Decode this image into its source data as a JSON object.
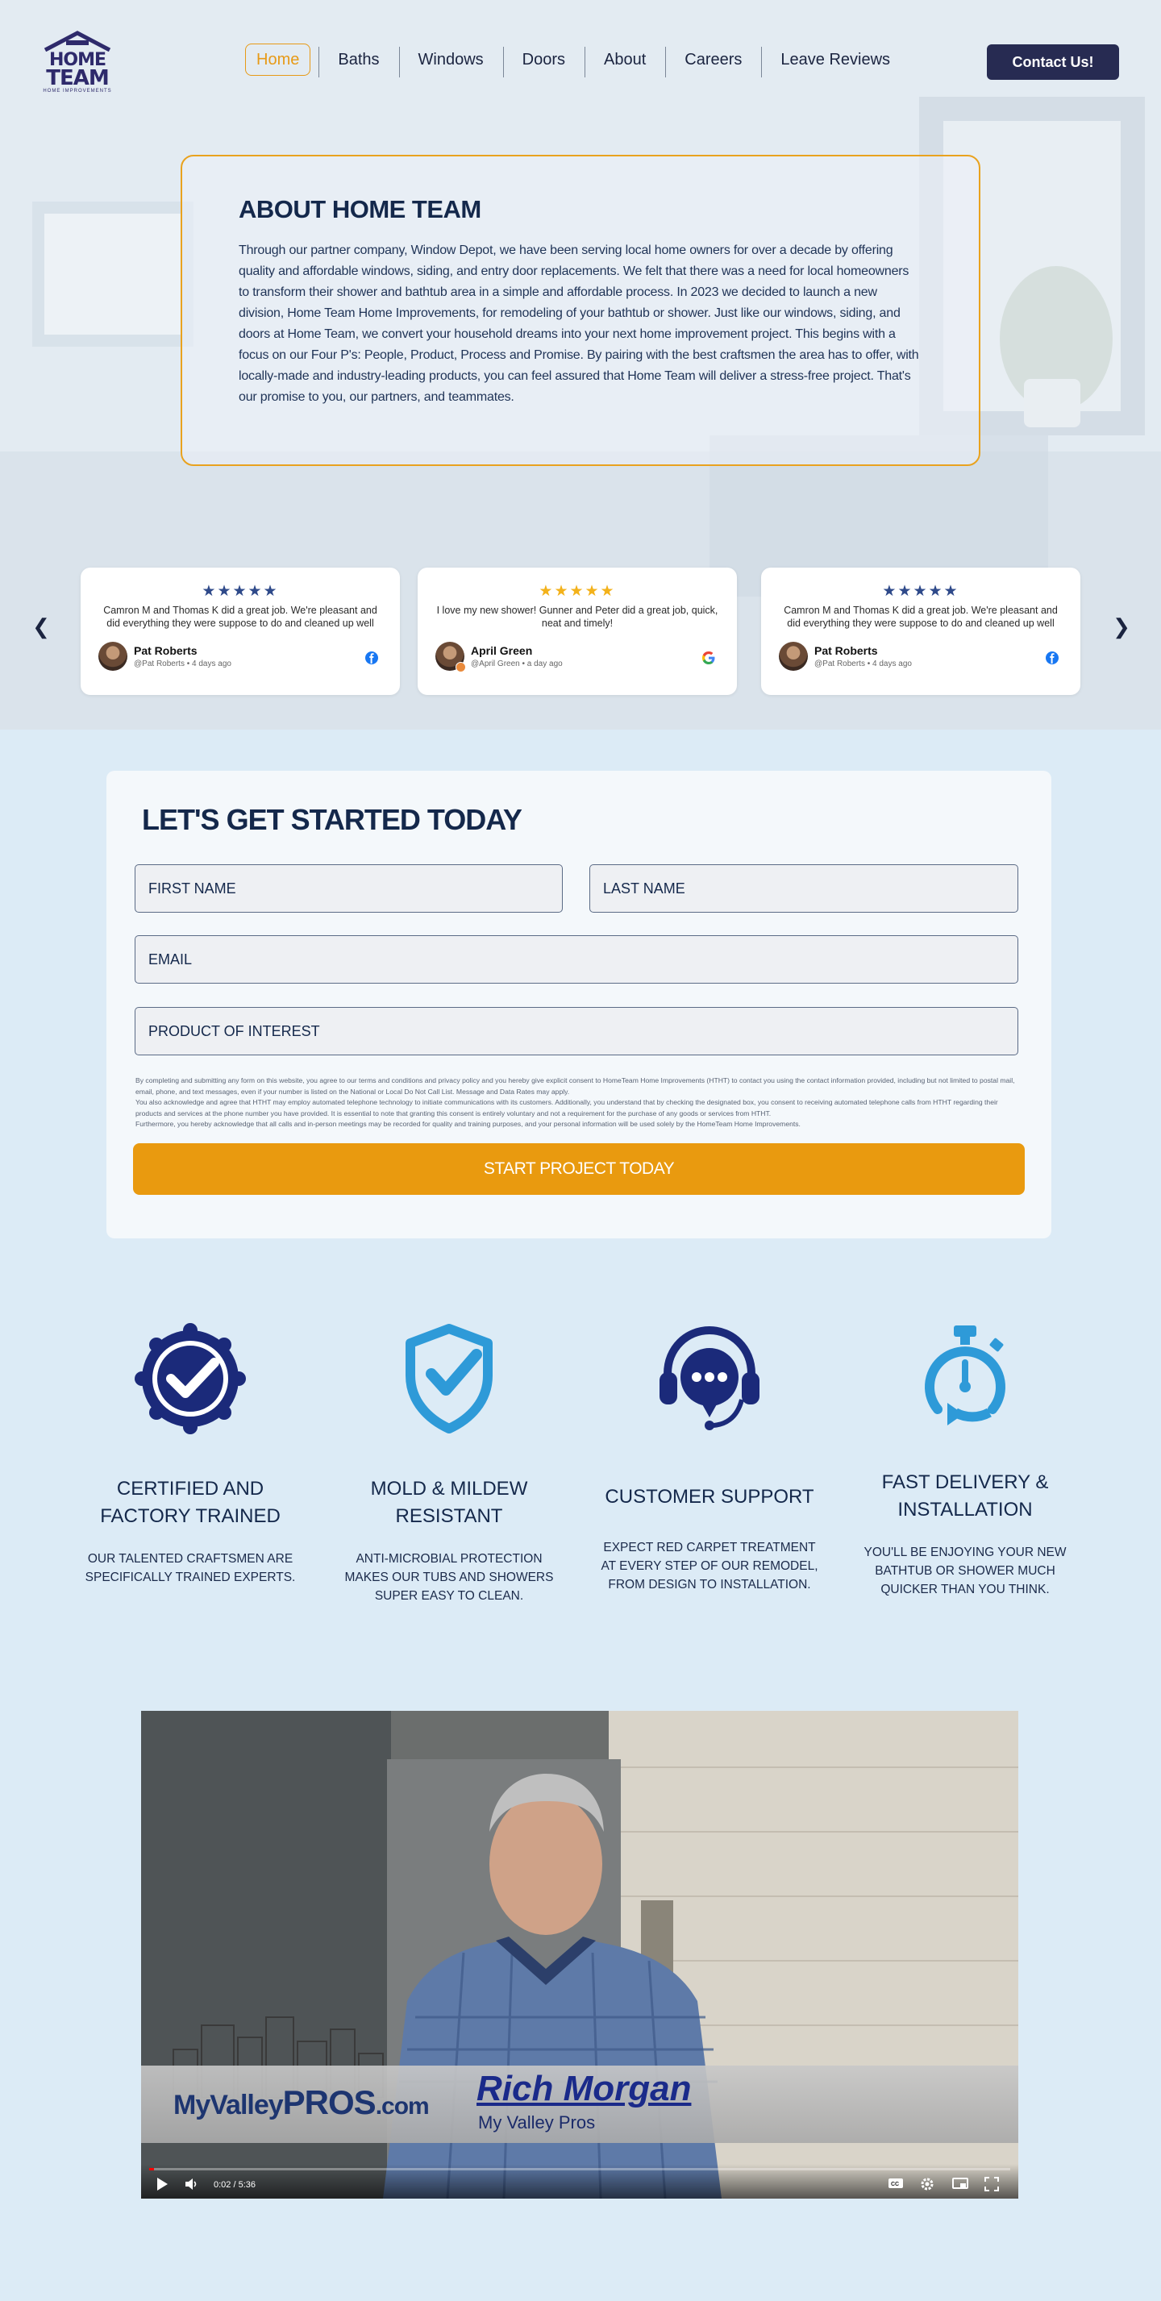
{
  "nav": {
    "logo_line1": "HOME",
    "logo_line2": "TEAM",
    "logo_sub": "HOME IMPROVEMENTS",
    "items": [
      "Home",
      "Baths",
      "Windows",
      "Doors",
      "About",
      "Careers",
      "Leave Reviews"
    ],
    "active": "Home",
    "contact_label": "Contact Us!"
  },
  "about": {
    "title": "ABOUT HOME TEAM",
    "body": "Through our partner company, Window Depot, we have been serving local home owners for over a decade by offering quality and affordable windows, siding, and entry door replacements. We felt that there was a need for local homeowners to transform their shower and bathtub area in a simple and affordable process. In 2023 we decided to launch a new division, Home Team Home Improvements, for remodeling of your bathtub or shower. Just like our windows, siding, and doors at Home Team, we convert your household dreams into your next home improvement project. This begins with a focus on our Four P's: People, Product, Process and Promise. By pairing with the best craftsmen the area has to offer, with locally-made and industry-leading products, you can feel assured that Home Team will deliver a stress-free project. That's our promise to you, our partners, and teammates."
  },
  "reviews": [
    {
      "stars": "★★★★★",
      "star_color": "#2f4a8a",
      "text": "Camron M and Thomas K did a great job. We're pleasant and did everything they were suppose to do and cleaned up well",
      "name": "Pat Roberts",
      "meta": "@Pat Roberts • 4 days ago",
      "source": "facebook-icon"
    },
    {
      "stars": "★★★★★",
      "star_color": "#f3b21b",
      "text": "I love my new shower! Gunner and Peter did a great job, quick, neat and timely!",
      "name": "April Green",
      "meta": "@April Green • a day ago",
      "source": "google-icon"
    },
    {
      "stars": "★★★★★",
      "star_color": "#2f4a8a",
      "text": "Camron M and Thomas K did a great job. We're pleasant and did everything they were suppose to do and cleaned up well",
      "name": "Pat Roberts",
      "meta": "@Pat Roberts • 4 days ago",
      "source": "facebook-icon"
    }
  ],
  "form": {
    "title": "LET'S GET STARTED TODAY",
    "first_name_placeholder": "FIRST NAME",
    "last_name_placeholder": "LAST NAME",
    "email_placeholder": "EMAIL",
    "product_placeholder": "PRODUCT OF INTEREST",
    "disclaimer_1": "By completing and submitting any form on this website, you agree to our terms and conditions and privacy policy and you hereby give explicit consent to HomeTeam Home Improvements (HTHT) to contact you using the contact information provided, including but not limited to postal mail, email, phone, and text messages, even if your number is listed on the National or Local Do Not Call List. Message and Data Rates may apply.",
    "disclaimer_2": "You also acknowledge and agree that HTHT may employ automated telephone technology to initiate communications with its customers. Additionally, you understand that by checking the designated box, you consent to receiving automated telephone calls from HTHT regarding their products and services at the phone number you have provided. It is essential to note that granting this consent is entirely voluntary and not a requirement for the purchase of any goods or services from HTHT.",
    "disclaimer_3": "Furthermore, you hereby acknowledge that all calls and in-person meetings may be recorded for quality and training purposes, and your personal information will be used solely by the HomeTeam Home Improvements.",
    "submit_label": "START PROJECT TODAY"
  },
  "features": [
    {
      "icon": "certified-badge-icon",
      "title": "CERTIFIED AND FACTORY TRAINED",
      "desc": "OUR TALENTED CRAFTSMEN ARE SPECIFICALLY TRAINED EXPERTS."
    },
    {
      "icon": "shield-check-icon",
      "title": "MOLD & MILDEW RESISTANT",
      "desc": "ANTI-MICROBIAL PROTECTION MAKES OUR TUBS AND SHOWERS SUPER EASY TO CLEAN."
    },
    {
      "icon": "headset-chat-icon",
      "title": "CUSTOMER SUPPORT",
      "desc": "EXPECT RED CARPET TREATMENT AT EVERY STEP OF OUR REMODEL, FROM DESIGN TO INSTALLATION."
    },
    {
      "icon": "stopwatch-icon",
      "title": "FAST DELIVERY & INSTALLATION",
      "desc": "YOU'LL BE ENJOYING YOUR NEW BATHTUB OR SHOWER MUCH QUICKER THAN YOU THINK."
    }
  ],
  "video": {
    "brand_prefix": "MyValley",
    "brand_main": "PROS",
    "brand_suffix": ".com",
    "presenter_name": "Rich Morgan",
    "presenter_org": "My Valley Pros",
    "time": "0:02 / 5:36",
    "progress_fraction": 0.006
  },
  "colors": {
    "accent": "#e99a0f",
    "navy": "#14284b",
    "icon_navy": "#1b2a7a",
    "icon_blue": "#2e9ad8"
  }
}
